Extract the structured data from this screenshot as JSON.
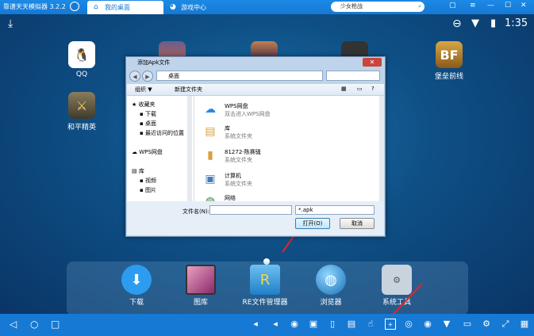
{
  "titlebar": {
    "app_title": "靠谱天天模拟器 3.2.2",
    "tabs": [
      {
        "label": "我的桌面",
        "active": true
      },
      {
        "label": "游戏中心",
        "active": false
      }
    ],
    "search_value": "少女枪战"
  },
  "statusbar": {
    "time": "1:35"
  },
  "desktop_apps": [
    {
      "label": "QQ"
    },
    {
      "label": "和平精英"
    },
    {
      "label": "堡垒前线"
    }
  ],
  "dock": [
    {
      "label": "下载"
    },
    {
      "label": "图库"
    },
    {
      "label": "RE文件管理器"
    },
    {
      "label": "浏览器"
    },
    {
      "label": "系统工具"
    }
  ],
  "dialog": {
    "title": "添加Apk文件",
    "address": "桌面",
    "toolbar": {
      "organize": "组织 ▼",
      "new_folder": "新建文件夹"
    },
    "nav": [
      "收藏夹",
      "下载",
      "桌面",
      "最近访问的位置",
      "WPS网盘",
      "库",
      "视频",
      "图片"
    ],
    "files": [
      {
        "name": "WPS网盘",
        "desc": "双击进入WPS网盘"
      },
      {
        "name": "库",
        "desc": "系统文件夹"
      },
      {
        "name": "81272-陈赛骚",
        "desc": "系统文件夹"
      },
      {
        "name": "计算机",
        "desc": "系统文件夹"
      },
      {
        "name": "网络",
        "desc": ""
      }
    ],
    "filename_label": "文件名(N):",
    "filter_value": "*.apk",
    "open_button": "打开(O)",
    "cancel_button": "取消"
  },
  "colors": {
    "accent": "#1679d4",
    "highlight_arrow": "#e0242c"
  }
}
